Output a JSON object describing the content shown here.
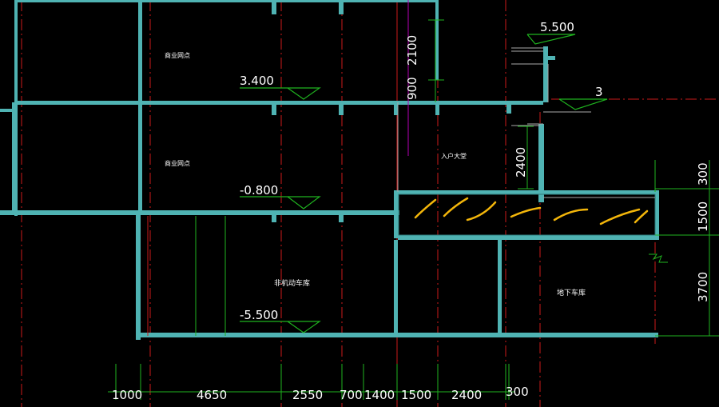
{
  "levels": {
    "top_right": "5.500",
    "floor2": "3.400",
    "floor1": "-0.800",
    "basement": "-5.500",
    "right_marker": "3"
  },
  "vertical_dims": {
    "d2100": "2100",
    "d900": "900",
    "d2400": "2400"
  },
  "right_dims": [
    "300",
    "1500",
    "3700"
  ],
  "bottom_dims": [
    "1000",
    "4650",
    "2550",
    "700",
    "1400",
    "1500",
    "2400",
    "300"
  ],
  "rooms": {
    "upper_left": "商业网点",
    "middle_left": "商业网点",
    "entrance_hall": "入户大堂",
    "bike_garage": "非机动车库",
    "underground_garage": "地下车库"
  },
  "colors": {
    "wall": "#4fb3b3",
    "axis": "#cc1a1a",
    "dimension": "#1fb31f",
    "highlight": "#f2b50a",
    "magenta": "#b300b3",
    "text": "#ffffff"
  }
}
